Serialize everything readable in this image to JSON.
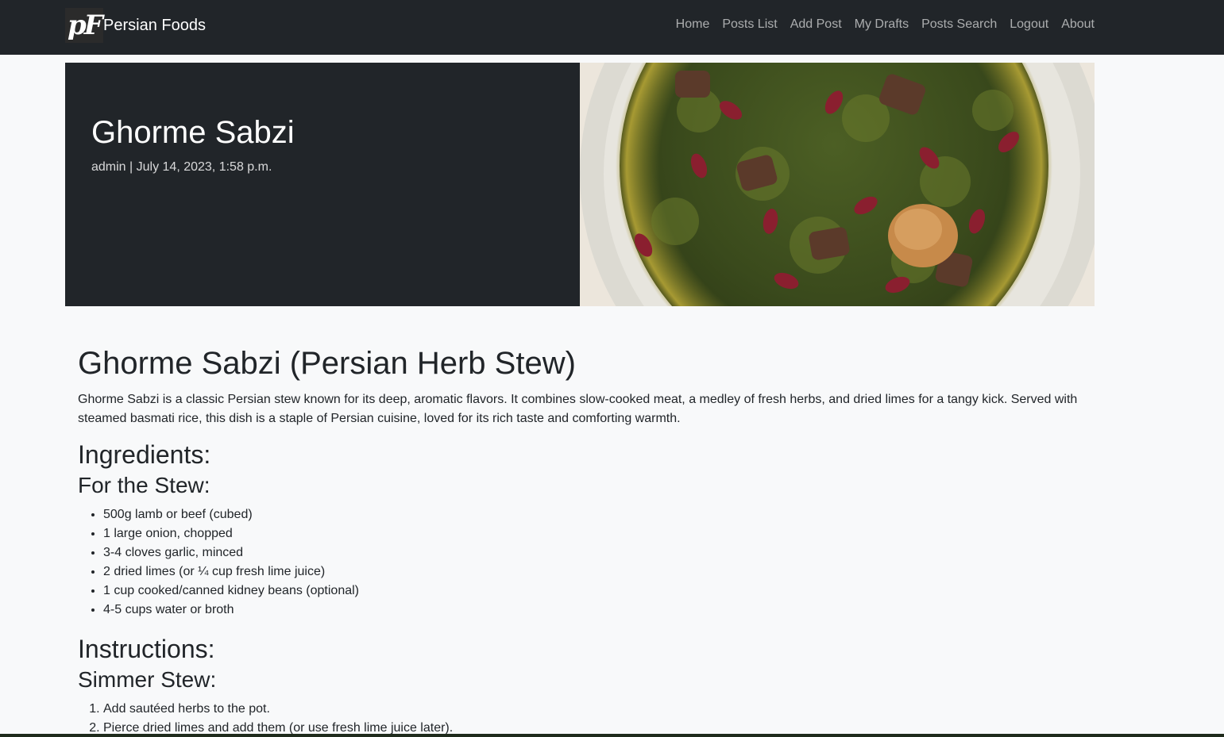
{
  "navbar": {
    "brand_logo": "pF",
    "brand_text": "Persian Foods",
    "links": [
      "Home",
      "Posts List",
      "Add Post",
      "My Drafts",
      "Posts Search",
      "Logout",
      "About"
    ]
  },
  "hero": {
    "title": "Ghorme Sabzi",
    "meta": "admin | July 14, 2023, 1:58 p.m.",
    "image_label": "ghorme-sabzi-photo"
  },
  "article": {
    "heading": "Ghorme Sabzi (Persian Herb Stew)",
    "intro": "Ghorme Sabzi is a classic Persian stew known for its deep, aromatic flavors. It combines slow-cooked meat, a medley of fresh herbs, and dried limes for a tangy kick. Served with steamed basmati rice, this dish is a staple of Persian cuisine, loved for its rich taste and comforting warmth.",
    "ingredients_heading": "Ingredients:",
    "stew_heading": "For the Stew:",
    "stew_items": [
      "500g lamb or beef (cubed)",
      "1 large onion, chopped",
      "3-4 cloves garlic, minced",
      "2 dried limes (or ¼ cup fresh lime juice)",
      "1 cup cooked/canned kidney beans (optional)",
      "4-5 cups water or broth"
    ],
    "instructions_heading": "Instructions:",
    "simmer_heading": "Simmer Stew:",
    "simmer_steps": [
      "Add sautéed herbs to the pot.",
      "Pierce dried limes and add them (or use fresh lime juice later)."
    ]
  },
  "colors": {
    "navbar_bg": "#212529",
    "page_bg": "#f8f9fa",
    "hero_bg": "#212529"
  }
}
